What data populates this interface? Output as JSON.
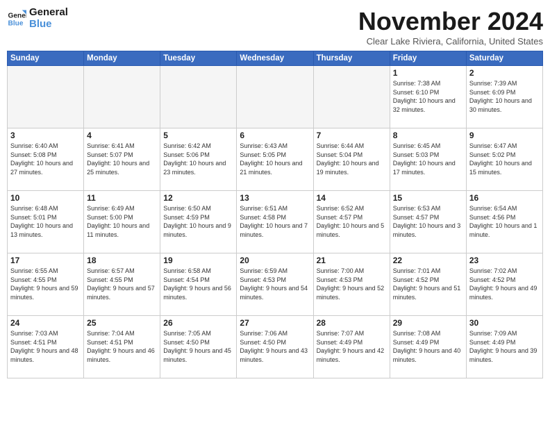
{
  "header": {
    "logo_line1": "General",
    "logo_line2": "Blue",
    "month_title": "November 2024",
    "location": "Clear Lake Riviera, California, United States"
  },
  "days_of_week": [
    "Sunday",
    "Monday",
    "Tuesday",
    "Wednesday",
    "Thursday",
    "Friday",
    "Saturday"
  ],
  "weeks": [
    [
      {
        "day": "",
        "sunrise": "",
        "sunset": "",
        "daylight": "",
        "empty": true
      },
      {
        "day": "",
        "sunrise": "",
        "sunset": "",
        "daylight": "",
        "empty": true
      },
      {
        "day": "",
        "sunrise": "",
        "sunset": "",
        "daylight": "",
        "empty": true
      },
      {
        "day": "",
        "sunrise": "",
        "sunset": "",
        "daylight": "",
        "empty": true
      },
      {
        "day": "",
        "sunrise": "",
        "sunset": "",
        "daylight": "",
        "empty": true
      },
      {
        "day": "1",
        "sunrise": "Sunrise: 7:38 AM",
        "sunset": "Sunset: 6:10 PM",
        "daylight": "Daylight: 10 hours and 32 minutes.",
        "empty": false
      },
      {
        "day": "2",
        "sunrise": "Sunrise: 7:39 AM",
        "sunset": "Sunset: 6:09 PM",
        "daylight": "Daylight: 10 hours and 30 minutes.",
        "empty": false
      }
    ],
    [
      {
        "day": "3",
        "sunrise": "Sunrise: 6:40 AM",
        "sunset": "Sunset: 5:08 PM",
        "daylight": "Daylight: 10 hours and 27 minutes.",
        "empty": false
      },
      {
        "day": "4",
        "sunrise": "Sunrise: 6:41 AM",
        "sunset": "Sunset: 5:07 PM",
        "daylight": "Daylight: 10 hours and 25 minutes.",
        "empty": false
      },
      {
        "day": "5",
        "sunrise": "Sunrise: 6:42 AM",
        "sunset": "Sunset: 5:06 PM",
        "daylight": "Daylight: 10 hours and 23 minutes.",
        "empty": false
      },
      {
        "day": "6",
        "sunrise": "Sunrise: 6:43 AM",
        "sunset": "Sunset: 5:05 PM",
        "daylight": "Daylight: 10 hours and 21 minutes.",
        "empty": false
      },
      {
        "day": "7",
        "sunrise": "Sunrise: 6:44 AM",
        "sunset": "Sunset: 5:04 PM",
        "daylight": "Daylight: 10 hours and 19 minutes.",
        "empty": false
      },
      {
        "day": "8",
        "sunrise": "Sunrise: 6:45 AM",
        "sunset": "Sunset: 5:03 PM",
        "daylight": "Daylight: 10 hours and 17 minutes.",
        "empty": false
      },
      {
        "day": "9",
        "sunrise": "Sunrise: 6:47 AM",
        "sunset": "Sunset: 5:02 PM",
        "daylight": "Daylight: 10 hours and 15 minutes.",
        "empty": false
      }
    ],
    [
      {
        "day": "10",
        "sunrise": "Sunrise: 6:48 AM",
        "sunset": "Sunset: 5:01 PM",
        "daylight": "Daylight: 10 hours and 13 minutes.",
        "empty": false
      },
      {
        "day": "11",
        "sunrise": "Sunrise: 6:49 AM",
        "sunset": "Sunset: 5:00 PM",
        "daylight": "Daylight: 10 hours and 11 minutes.",
        "empty": false
      },
      {
        "day": "12",
        "sunrise": "Sunrise: 6:50 AM",
        "sunset": "Sunset: 4:59 PM",
        "daylight": "Daylight: 10 hours and 9 minutes.",
        "empty": false
      },
      {
        "day": "13",
        "sunrise": "Sunrise: 6:51 AM",
        "sunset": "Sunset: 4:58 PM",
        "daylight": "Daylight: 10 hours and 7 minutes.",
        "empty": false
      },
      {
        "day": "14",
        "sunrise": "Sunrise: 6:52 AM",
        "sunset": "Sunset: 4:57 PM",
        "daylight": "Daylight: 10 hours and 5 minutes.",
        "empty": false
      },
      {
        "day": "15",
        "sunrise": "Sunrise: 6:53 AM",
        "sunset": "Sunset: 4:57 PM",
        "daylight": "Daylight: 10 hours and 3 minutes.",
        "empty": false
      },
      {
        "day": "16",
        "sunrise": "Sunrise: 6:54 AM",
        "sunset": "Sunset: 4:56 PM",
        "daylight": "Daylight: 10 hours and 1 minute.",
        "empty": false
      }
    ],
    [
      {
        "day": "17",
        "sunrise": "Sunrise: 6:55 AM",
        "sunset": "Sunset: 4:55 PM",
        "daylight": "Daylight: 9 hours and 59 minutes.",
        "empty": false
      },
      {
        "day": "18",
        "sunrise": "Sunrise: 6:57 AM",
        "sunset": "Sunset: 4:55 PM",
        "daylight": "Daylight: 9 hours and 57 minutes.",
        "empty": false
      },
      {
        "day": "19",
        "sunrise": "Sunrise: 6:58 AM",
        "sunset": "Sunset: 4:54 PM",
        "daylight": "Daylight: 9 hours and 56 minutes.",
        "empty": false
      },
      {
        "day": "20",
        "sunrise": "Sunrise: 6:59 AM",
        "sunset": "Sunset: 4:53 PM",
        "daylight": "Daylight: 9 hours and 54 minutes.",
        "empty": false
      },
      {
        "day": "21",
        "sunrise": "Sunrise: 7:00 AM",
        "sunset": "Sunset: 4:53 PM",
        "daylight": "Daylight: 9 hours and 52 minutes.",
        "empty": false
      },
      {
        "day": "22",
        "sunrise": "Sunrise: 7:01 AM",
        "sunset": "Sunset: 4:52 PM",
        "daylight": "Daylight: 9 hours and 51 minutes.",
        "empty": false
      },
      {
        "day": "23",
        "sunrise": "Sunrise: 7:02 AM",
        "sunset": "Sunset: 4:52 PM",
        "daylight": "Daylight: 9 hours and 49 minutes.",
        "empty": false
      }
    ],
    [
      {
        "day": "24",
        "sunrise": "Sunrise: 7:03 AM",
        "sunset": "Sunset: 4:51 PM",
        "daylight": "Daylight: 9 hours and 48 minutes.",
        "empty": false
      },
      {
        "day": "25",
        "sunrise": "Sunrise: 7:04 AM",
        "sunset": "Sunset: 4:51 PM",
        "daylight": "Daylight: 9 hours and 46 minutes.",
        "empty": false
      },
      {
        "day": "26",
        "sunrise": "Sunrise: 7:05 AM",
        "sunset": "Sunset: 4:50 PM",
        "daylight": "Daylight: 9 hours and 45 minutes.",
        "empty": false
      },
      {
        "day": "27",
        "sunrise": "Sunrise: 7:06 AM",
        "sunset": "Sunset: 4:50 PM",
        "daylight": "Daylight: 9 hours and 43 minutes.",
        "empty": false
      },
      {
        "day": "28",
        "sunrise": "Sunrise: 7:07 AM",
        "sunset": "Sunset: 4:49 PM",
        "daylight": "Daylight: 9 hours and 42 minutes.",
        "empty": false
      },
      {
        "day": "29",
        "sunrise": "Sunrise: 7:08 AM",
        "sunset": "Sunset: 4:49 PM",
        "daylight": "Daylight: 9 hours and 40 minutes.",
        "empty": false
      },
      {
        "day": "30",
        "sunrise": "Sunrise: 7:09 AM",
        "sunset": "Sunset: 4:49 PM",
        "daylight": "Daylight: 9 hours and 39 minutes.",
        "empty": false
      }
    ]
  ]
}
